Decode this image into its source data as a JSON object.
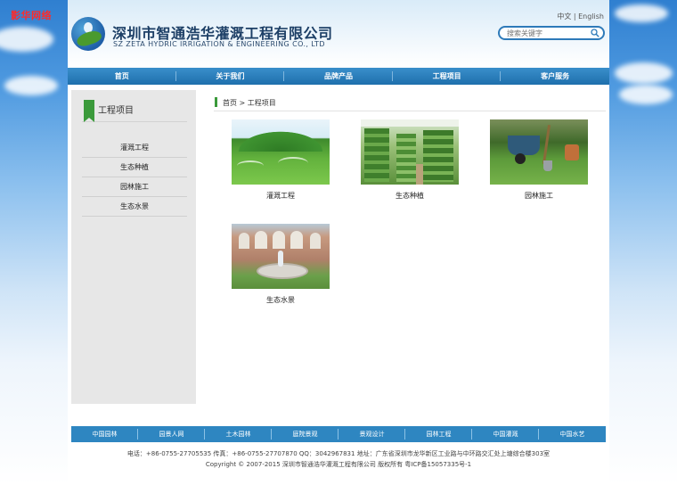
{
  "corner_text": "影华网络",
  "header": {
    "company_cn": "深圳市智通浩华灌溉工程有限公司",
    "company_en": "SZ ZETA HYDRIC IRRIGATION & ENGINEERING CO., LTD",
    "lang_cn": "中文",
    "lang_sep": " | ",
    "lang_en": "English",
    "search_placeholder": "搜索关键字"
  },
  "nav": [
    {
      "label": "首页"
    },
    {
      "label": "关于我们"
    },
    {
      "label": "品牌产品"
    },
    {
      "label": "工程项目"
    },
    {
      "label": "客户服务"
    }
  ],
  "sidebar": {
    "title": "工程项目",
    "items": [
      {
        "label": "灌溉工程"
      },
      {
        "label": "生态种植"
      },
      {
        "label": "园林施工"
      },
      {
        "label": "生态水景"
      }
    ]
  },
  "breadcrumb": "首页 > 工程项目",
  "products": [
    {
      "caption": "灌溉工程",
      "icon": "lawn-sprinkler-photo"
    },
    {
      "caption": "生态种植",
      "icon": "greenhouse-photo"
    },
    {
      "caption": "园林施工",
      "icon": "garden-tools-photo"
    },
    {
      "caption": "生态水景",
      "icon": "fountain-house-photo"
    }
  ],
  "links": [
    {
      "label": "中国园林"
    },
    {
      "label": "园景人网"
    },
    {
      "label": "土木园林"
    },
    {
      "label": "庭院景观"
    },
    {
      "label": "景观设计"
    },
    {
      "label": "园林工程"
    },
    {
      "label": "中国灌溉"
    },
    {
      "label": "中国水艺"
    }
  ],
  "footer": {
    "contact": "电话：+86-0755-27705535  传真：+86-0755-27707870  QQ：3042967831  地址：广东省深圳市龙华新区工业路与中环路交汇处上塘综合楼303室",
    "copyright": "Copyright © 2007-2015 深圳市智通浩华灌溉工程有限公司 版权所有 粤ICP备15057335号-1"
  },
  "colors": {
    "nav_blue": "#1e6fac",
    "accent_green": "#3b9a3b",
    "sidebar_bg": "#e7e7e7"
  }
}
